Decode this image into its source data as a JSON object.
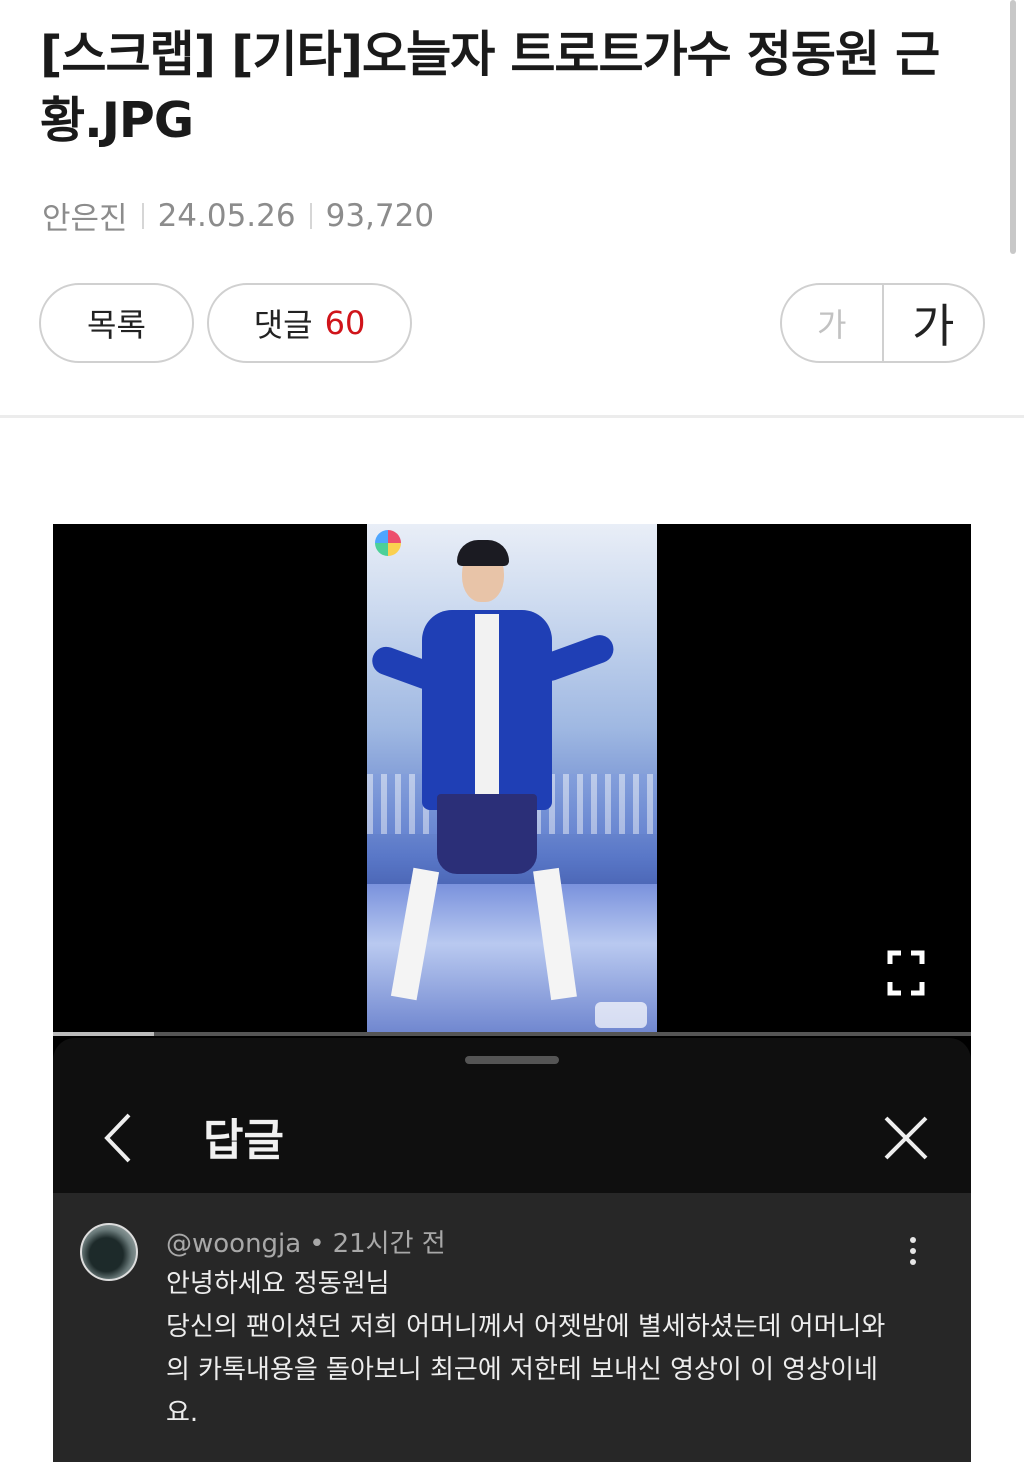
{
  "post": {
    "title": "[스크랩] [기타]오늘자 트로트가수 정동원 근황.JPG",
    "author": "안은진",
    "date": "24.05.26",
    "views": "93,720"
  },
  "actions": {
    "list_label": "목록",
    "comment_label": "댓글",
    "comment_count": "60",
    "font_small_label": "가",
    "font_large_label": "가"
  },
  "embedded_screenshot": {
    "video_progress": 0.11,
    "replies_panel": {
      "title": "답글"
    },
    "comment": {
      "handle": "@woongja",
      "time": "21시간 전",
      "text_line1": "안녕하세요 정동원님",
      "text_line2": "당신의 팬이셨던 저희 어머니께서 어젯밤에 별세하셨는데 어머니와의 카톡내용을 돌아보니 최근에 저한테 보내신 영상이 이 영상이네요."
    }
  },
  "colors": {
    "comment_count": "#d0141a",
    "panel_bg": "#0f0f0f",
    "comment_bg": "#272727",
    "jacket": "#1f3fb5"
  }
}
